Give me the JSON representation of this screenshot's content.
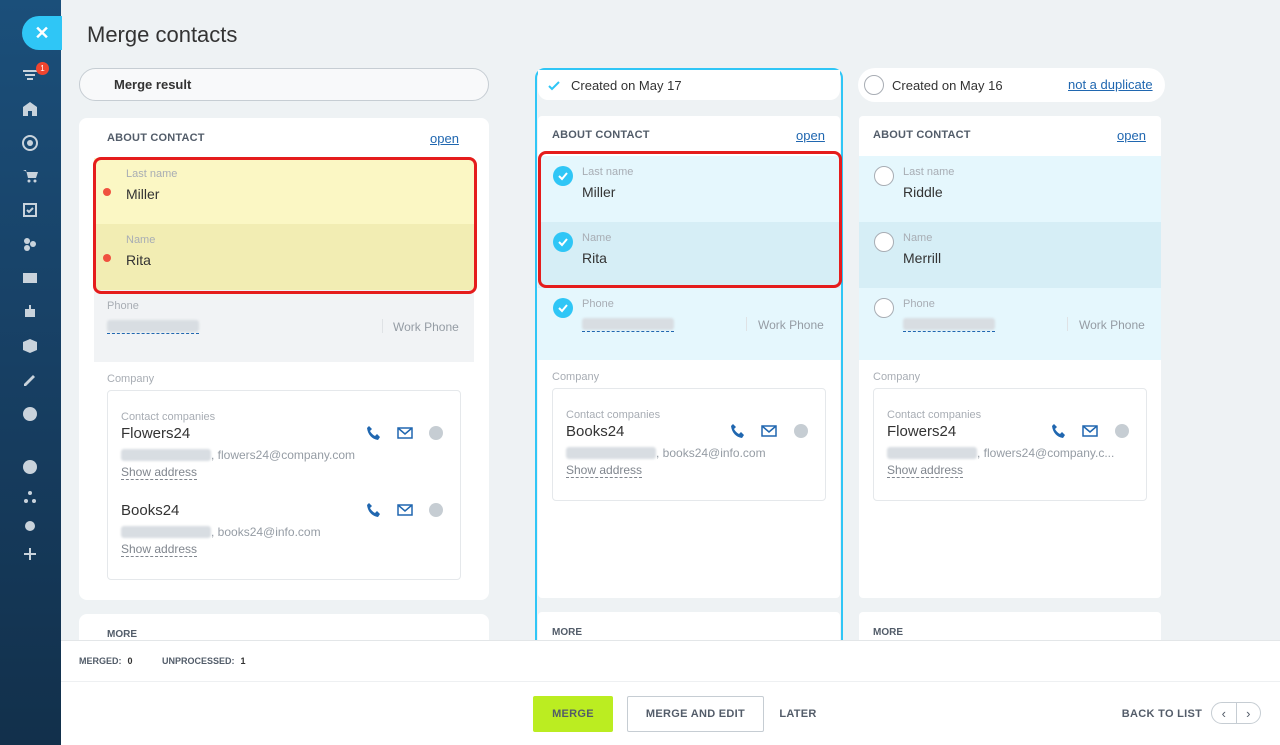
{
  "app": {
    "title": "Merge contacts",
    "close_icon": "close-icon",
    "notification_count": "1"
  },
  "sidebar": {
    "icons": [
      "filter-icon",
      "home-icon",
      "target-icon",
      "cart-icon",
      "tasks-icon",
      "crm-icon",
      "contact-card-icon",
      "robot-icon",
      "box-icon",
      "signature-icon",
      "more-icon",
      "help-icon",
      "sitemap-icon",
      "settings-icon",
      "plus-icon"
    ]
  },
  "result": {
    "header": "Merge result",
    "section": "ABOUT CONTACT",
    "open": "open",
    "last_name_label": "Last name",
    "last_name": "Miller",
    "name_label": "Name",
    "name": "Rita",
    "phone_label": "Phone",
    "phone_type": "Work Phone",
    "company_label": "Company",
    "contact_companies_label": "Contact companies",
    "companies": [
      {
        "name": "Flowers24",
        "email": ", flowers24@company.com",
        "show_address": "Show address"
      },
      {
        "name": "Books24",
        "email": ", books24@info.com",
        "show_address": "Show address"
      }
    ],
    "more": "MORE"
  },
  "dup1": {
    "header": "Created on May 17",
    "section": "ABOUT CONTACT",
    "open": "open",
    "last_name_label": "Last name",
    "last_name": "Miller",
    "name_label": "Name",
    "name": "Rita",
    "phone_label": "Phone",
    "phone_type": "Work Phone",
    "company_label": "Company",
    "contact_companies_label": "Contact companies",
    "company": {
      "name": "Books24",
      "email": ", books24@info.com",
      "show_address": "Show address"
    },
    "more": "MORE"
  },
  "dup2": {
    "header": "Created on May 16",
    "not_duplicate": "not a duplicate",
    "section": "ABOUT CONTACT",
    "open": "open",
    "last_name_label": "Last name",
    "last_name": "Riddle",
    "name_label": "Name",
    "name": "Merrill",
    "phone_label": "Phone",
    "phone_type": "Work Phone",
    "company_label": "Company",
    "contact_companies_label": "Contact companies",
    "company": {
      "name": "Flowers24",
      "email": ", flowers24@company.c...",
      "show_address": "Show address"
    },
    "more": "MORE"
  },
  "footer": {
    "merged_label": "MERGED:",
    "merged": "0",
    "unprocessed_label": "UNPROCESSED:",
    "unprocessed": "1",
    "merge": "MERGE",
    "merge_and_edit": "MERGE AND EDIT",
    "later": "LATER",
    "back_to_list": "BACK TO LIST",
    "prev": "‹",
    "next": "›"
  },
  "colors": {
    "accent": "#2fc6f6",
    "merge_button": "#bbed21",
    "highlight_yellow": "#fbf7c4",
    "highlight_blue": "#e5f7fd",
    "red_outline": "#e51c1c",
    "link": "#2067b0"
  }
}
